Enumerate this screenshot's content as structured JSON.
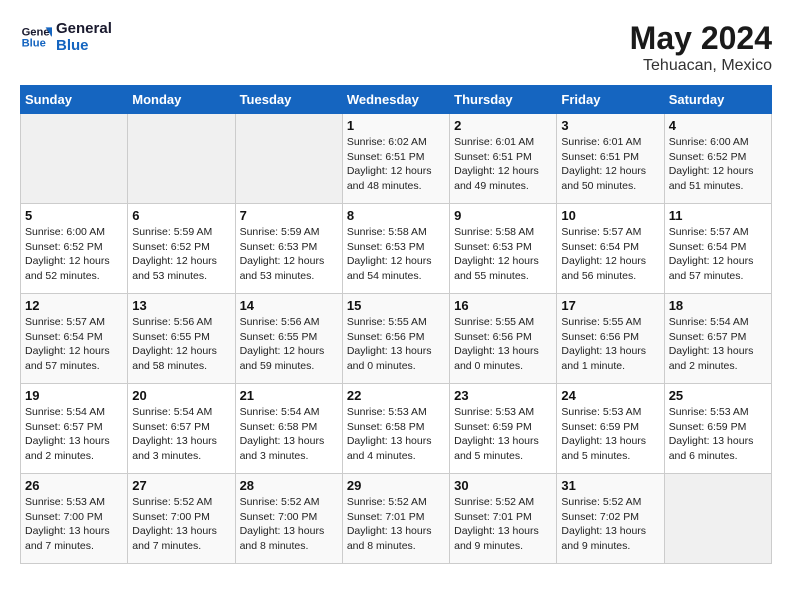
{
  "header": {
    "logo_line1": "General",
    "logo_line2": "Blue",
    "title": "May 2024",
    "subtitle": "Tehuacan, Mexico"
  },
  "days_of_week": [
    "Sunday",
    "Monday",
    "Tuesday",
    "Wednesday",
    "Thursday",
    "Friday",
    "Saturday"
  ],
  "weeks": [
    [
      {
        "day": "",
        "info": ""
      },
      {
        "day": "",
        "info": ""
      },
      {
        "day": "",
        "info": ""
      },
      {
        "day": "1",
        "info": "Sunrise: 6:02 AM\nSunset: 6:51 PM\nDaylight: 12 hours\nand 48 minutes."
      },
      {
        "day": "2",
        "info": "Sunrise: 6:01 AM\nSunset: 6:51 PM\nDaylight: 12 hours\nand 49 minutes."
      },
      {
        "day": "3",
        "info": "Sunrise: 6:01 AM\nSunset: 6:51 PM\nDaylight: 12 hours\nand 50 minutes."
      },
      {
        "day": "4",
        "info": "Sunrise: 6:00 AM\nSunset: 6:52 PM\nDaylight: 12 hours\nand 51 minutes."
      }
    ],
    [
      {
        "day": "5",
        "info": "Sunrise: 6:00 AM\nSunset: 6:52 PM\nDaylight: 12 hours\nand 52 minutes."
      },
      {
        "day": "6",
        "info": "Sunrise: 5:59 AM\nSunset: 6:52 PM\nDaylight: 12 hours\nand 53 minutes."
      },
      {
        "day": "7",
        "info": "Sunrise: 5:59 AM\nSunset: 6:53 PM\nDaylight: 12 hours\nand 53 minutes."
      },
      {
        "day": "8",
        "info": "Sunrise: 5:58 AM\nSunset: 6:53 PM\nDaylight: 12 hours\nand 54 minutes."
      },
      {
        "day": "9",
        "info": "Sunrise: 5:58 AM\nSunset: 6:53 PM\nDaylight: 12 hours\nand 55 minutes."
      },
      {
        "day": "10",
        "info": "Sunrise: 5:57 AM\nSunset: 6:54 PM\nDaylight: 12 hours\nand 56 minutes."
      },
      {
        "day": "11",
        "info": "Sunrise: 5:57 AM\nSunset: 6:54 PM\nDaylight: 12 hours\nand 57 minutes."
      }
    ],
    [
      {
        "day": "12",
        "info": "Sunrise: 5:57 AM\nSunset: 6:54 PM\nDaylight: 12 hours\nand 57 minutes."
      },
      {
        "day": "13",
        "info": "Sunrise: 5:56 AM\nSunset: 6:55 PM\nDaylight: 12 hours\nand 58 minutes."
      },
      {
        "day": "14",
        "info": "Sunrise: 5:56 AM\nSunset: 6:55 PM\nDaylight: 12 hours\nand 59 minutes."
      },
      {
        "day": "15",
        "info": "Sunrise: 5:55 AM\nSunset: 6:56 PM\nDaylight: 13 hours\nand 0 minutes."
      },
      {
        "day": "16",
        "info": "Sunrise: 5:55 AM\nSunset: 6:56 PM\nDaylight: 13 hours\nand 0 minutes."
      },
      {
        "day": "17",
        "info": "Sunrise: 5:55 AM\nSunset: 6:56 PM\nDaylight: 13 hours\nand 1 minute."
      },
      {
        "day": "18",
        "info": "Sunrise: 5:54 AM\nSunset: 6:57 PM\nDaylight: 13 hours\nand 2 minutes."
      }
    ],
    [
      {
        "day": "19",
        "info": "Sunrise: 5:54 AM\nSunset: 6:57 PM\nDaylight: 13 hours\nand 2 minutes."
      },
      {
        "day": "20",
        "info": "Sunrise: 5:54 AM\nSunset: 6:57 PM\nDaylight: 13 hours\nand 3 minutes."
      },
      {
        "day": "21",
        "info": "Sunrise: 5:54 AM\nSunset: 6:58 PM\nDaylight: 13 hours\nand 3 minutes."
      },
      {
        "day": "22",
        "info": "Sunrise: 5:53 AM\nSunset: 6:58 PM\nDaylight: 13 hours\nand 4 minutes."
      },
      {
        "day": "23",
        "info": "Sunrise: 5:53 AM\nSunset: 6:59 PM\nDaylight: 13 hours\nand 5 minutes."
      },
      {
        "day": "24",
        "info": "Sunrise: 5:53 AM\nSunset: 6:59 PM\nDaylight: 13 hours\nand 5 minutes."
      },
      {
        "day": "25",
        "info": "Sunrise: 5:53 AM\nSunset: 6:59 PM\nDaylight: 13 hours\nand 6 minutes."
      }
    ],
    [
      {
        "day": "26",
        "info": "Sunrise: 5:53 AM\nSunset: 7:00 PM\nDaylight: 13 hours\nand 7 minutes."
      },
      {
        "day": "27",
        "info": "Sunrise: 5:52 AM\nSunset: 7:00 PM\nDaylight: 13 hours\nand 7 minutes."
      },
      {
        "day": "28",
        "info": "Sunrise: 5:52 AM\nSunset: 7:00 PM\nDaylight: 13 hours\nand 8 minutes."
      },
      {
        "day": "29",
        "info": "Sunrise: 5:52 AM\nSunset: 7:01 PM\nDaylight: 13 hours\nand 8 minutes."
      },
      {
        "day": "30",
        "info": "Sunrise: 5:52 AM\nSunset: 7:01 PM\nDaylight: 13 hours\nand 9 minutes."
      },
      {
        "day": "31",
        "info": "Sunrise: 5:52 AM\nSunset: 7:02 PM\nDaylight: 13 hours\nand 9 minutes."
      },
      {
        "day": "",
        "info": ""
      }
    ]
  ]
}
